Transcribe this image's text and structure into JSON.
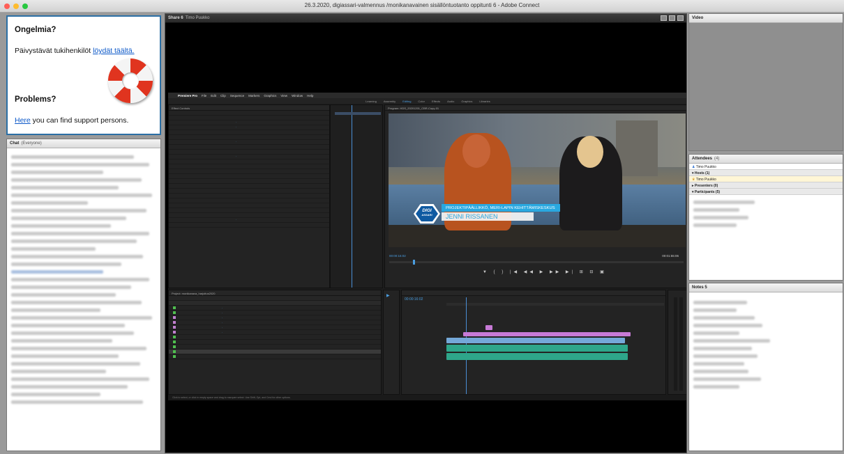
{
  "window": {
    "title": "26.3.2020, digiassari-valmennus /monikanavainen sisällöntuotanto oppitunti 6 - Adobe Connect",
    "traffic_lights": [
      "#ff5f57",
      "#febc2e",
      "#28c840"
    ]
  },
  "help_pod": {
    "heading_fi": "Ongelmia?",
    "text_fi": "Päivystävät tukihenkilöt ",
    "link_fi": "löydät täältä.",
    "heading_en": "Problems?",
    "link_en": "Here",
    "text_en": " you can find support persons."
  },
  "chat": {
    "title": "Chat",
    "scope": "(Everyone)"
  },
  "share": {
    "title": "Share 6",
    "presenter": "Timo Puukko",
    "premiere": {
      "app": "Premiere Pro",
      "menu": [
        "File",
        "Edit",
        "Clip",
        "Sequence",
        "Markers",
        "Graphics",
        "View",
        "Window",
        "Help"
      ],
      "workspaces": [
        "Learning",
        "Assembly",
        "Editing",
        "Color",
        "Effects",
        "Audio",
        "Graphics",
        "Libraries"
      ],
      "active_workspace": "Editing",
      "effect_controls_title": "Effect Controls",
      "program_title": "Program: HDS_20201201_CBR-Copy-01",
      "timecode_program": "00:00:16:02",
      "timecode_end": "00:01:55:06",
      "lower_third": {
        "badge_line1": "DIGI",
        "badge_line2": "ASSARI",
        "role": "PROJEKTIPÄÄLLIKKÖ, MERI-LAPIN KEHITTÄMISKESKUS",
        "name": "JENNI RISSANEN"
      },
      "project_title": "Project: monikanava_harjoitus2020",
      "timeline_timecode": "00:00:16:02",
      "status": "Click to select, or click in empty space and drag to marquee select. Use Shift, Opt, and Cmd for other options."
    }
  },
  "video_pod": {
    "title": "Video"
  },
  "attendees": {
    "title": "Attendees",
    "count": "(4)",
    "presenter_row": "Timo Puukko",
    "hosts_label": "Hosts (1)",
    "host_name": "Timo Puukko",
    "presenters_label": "Presenters (0)",
    "participants_label": "Participants (5)"
  },
  "notes": {
    "title": "Notes 5"
  }
}
